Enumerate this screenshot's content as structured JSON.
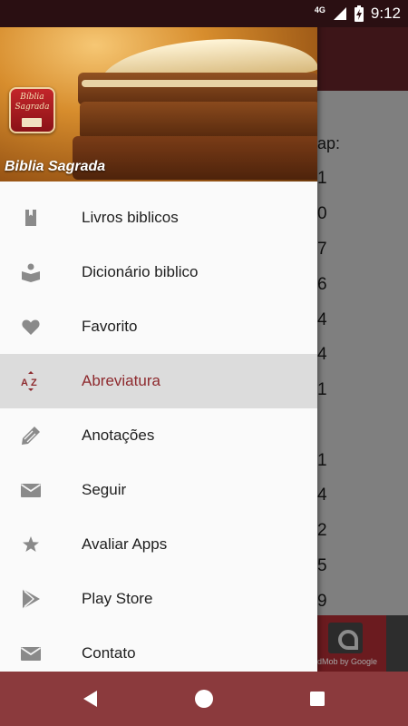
{
  "status_bar": {
    "network": "4G",
    "time": "9:12",
    "icons": [
      "signal-icon",
      "battery-charging-icon"
    ]
  },
  "background_app": {
    "visible_text": [
      "ap:",
      "1",
      "0",
      "7",
      "6",
      "4",
      "4",
      "1",
      "1",
      "4",
      "2",
      "5",
      "9"
    ],
    "ad_text": "dMob by Google"
  },
  "drawer": {
    "header": {
      "logo_text": "Bíblia Sagrada",
      "title": "Biblia Sagrada"
    },
    "items": [
      {
        "label": "Livros biblicos",
        "icon": "bookmark-book-icon"
      },
      {
        "label": "Dicionário biblico",
        "icon": "reader-icon"
      },
      {
        "label": "Favorito",
        "icon": "heart-icon"
      },
      {
        "label": "Abreviatura",
        "icon": "sort-az-icon",
        "selected": true
      },
      {
        "label": "Anotações",
        "icon": "pencil-icon"
      },
      {
        "label": "Seguir",
        "icon": "mail-icon"
      },
      {
        "label": "Avaliar Apps",
        "icon": "star-icon"
      },
      {
        "label": "Play Store",
        "icon": "play-store-icon"
      },
      {
        "label": "Contato",
        "icon": "mail-icon"
      }
    ]
  },
  "colors": {
    "accent": "#8e2a2e",
    "nav_bar": "#8b3a3d",
    "status_bar": "#2a0f12",
    "icon_gray": "#8a8a8a"
  }
}
